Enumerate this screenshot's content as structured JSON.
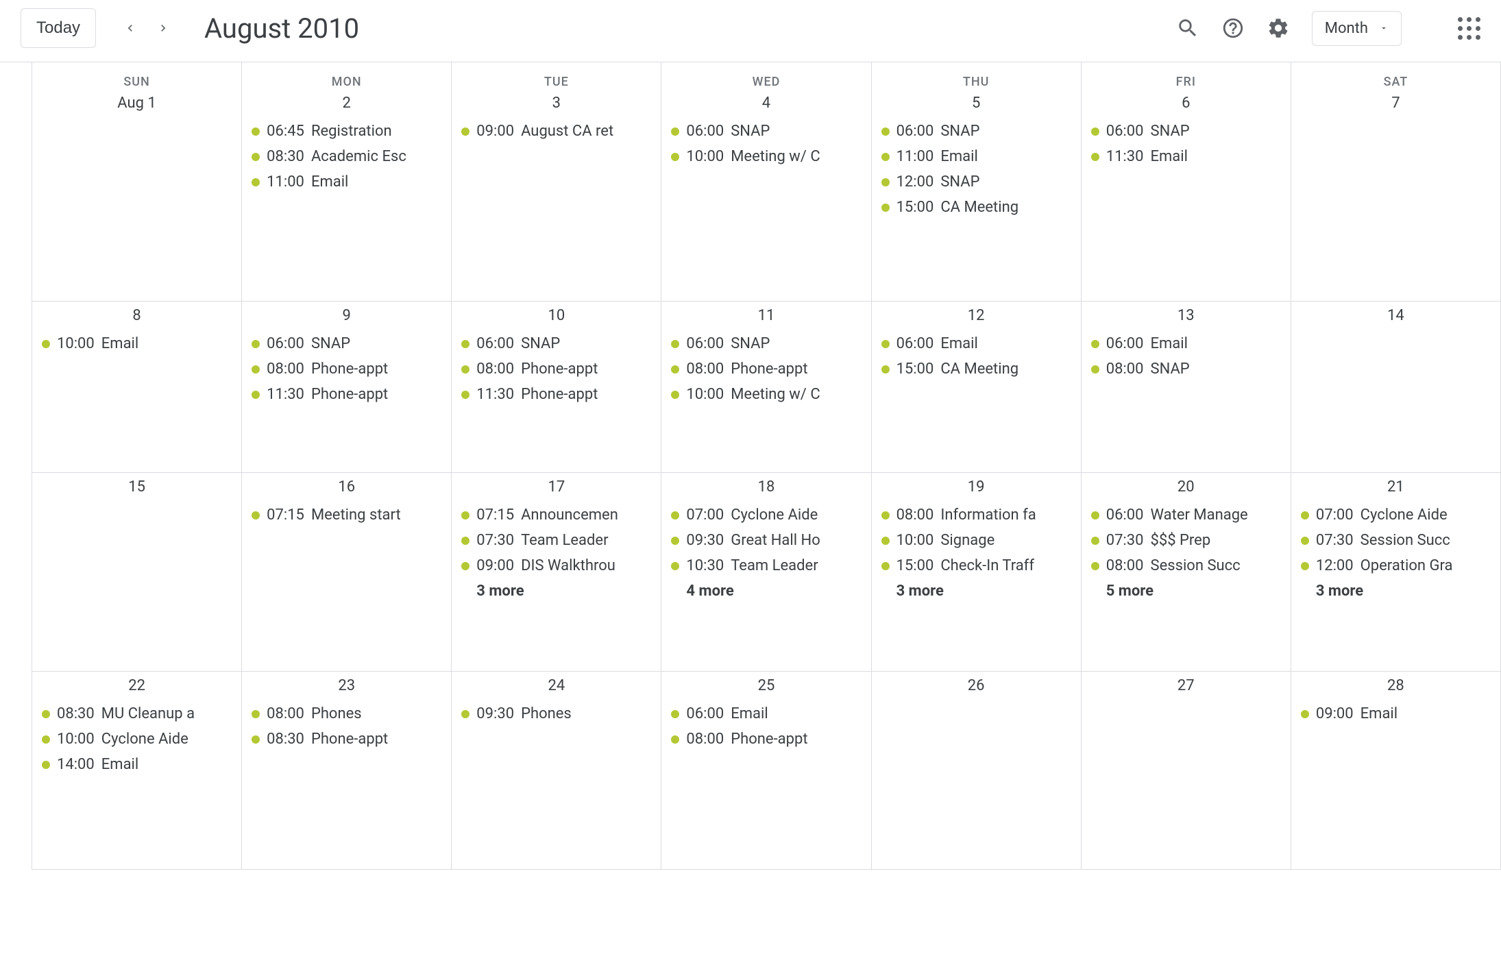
{
  "header": {
    "today_label": "Today",
    "month_title": "August 2010",
    "view_label": "Month"
  },
  "weekdays": [
    "SUN",
    "MON",
    "TUE",
    "WED",
    "THU",
    "FRI",
    "SAT"
  ],
  "event_dot_color": "#b3c833",
  "weeks": [
    [
      {
        "num": "Aug 1",
        "events": [],
        "more": ""
      },
      {
        "num": "2",
        "events": [
          {
            "time": "06:45",
            "title": "Registration"
          },
          {
            "time": "08:30",
            "title": "Academic Esc"
          },
          {
            "time": "11:00",
            "title": "Email"
          }
        ],
        "more": ""
      },
      {
        "num": "3",
        "events": [
          {
            "time": "09:00",
            "title": "August CA ret"
          }
        ],
        "more": ""
      },
      {
        "num": "4",
        "events": [
          {
            "time": "06:00",
            "title": "SNAP"
          },
          {
            "time": "10:00",
            "title": "Meeting w/ C"
          }
        ],
        "more": ""
      },
      {
        "num": "5",
        "events": [
          {
            "time": "06:00",
            "title": "SNAP"
          },
          {
            "time": "11:00",
            "title": "Email"
          },
          {
            "time": "12:00",
            "title": "SNAP"
          },
          {
            "time": "15:00",
            "title": "CA Meeting"
          }
        ],
        "more": ""
      },
      {
        "num": "6",
        "events": [
          {
            "time": "06:00",
            "title": "SNAP"
          },
          {
            "time": "11:30",
            "title": "Email"
          }
        ],
        "more": ""
      },
      {
        "num": "7",
        "events": [],
        "more": ""
      }
    ],
    [
      {
        "num": "8",
        "events": [
          {
            "time": "10:00",
            "title": "Email"
          }
        ],
        "more": ""
      },
      {
        "num": "9",
        "events": [
          {
            "time": "06:00",
            "title": "SNAP"
          },
          {
            "time": "08:00",
            "title": "Phone-appt"
          },
          {
            "time": "11:30",
            "title": "Phone-appt"
          }
        ],
        "more": ""
      },
      {
        "num": "10",
        "events": [
          {
            "time": "06:00",
            "title": "SNAP"
          },
          {
            "time": "08:00",
            "title": "Phone-appt"
          },
          {
            "time": "11:30",
            "title": "Phone-appt"
          }
        ],
        "more": ""
      },
      {
        "num": "11",
        "events": [
          {
            "time": "06:00",
            "title": "SNAP"
          },
          {
            "time": "08:00",
            "title": "Phone-appt"
          },
          {
            "time": "10:00",
            "title": "Meeting w/ C"
          }
        ],
        "more": ""
      },
      {
        "num": "12",
        "events": [
          {
            "time": "06:00",
            "title": "Email"
          },
          {
            "time": "15:00",
            "title": "CA Meeting"
          }
        ],
        "more": ""
      },
      {
        "num": "13",
        "events": [
          {
            "time": "06:00",
            "title": "Email"
          },
          {
            "time": "08:00",
            "title": "SNAP"
          }
        ],
        "more": ""
      },
      {
        "num": "14",
        "events": [],
        "more": ""
      }
    ],
    [
      {
        "num": "15",
        "events": [],
        "more": ""
      },
      {
        "num": "16",
        "events": [
          {
            "time": "07:15",
            "title": "Meeting start"
          }
        ],
        "more": ""
      },
      {
        "num": "17",
        "events": [
          {
            "time": "07:15",
            "title": "Announcemen"
          },
          {
            "time": "07:30",
            "title": "Team Leader"
          },
          {
            "time": "09:00",
            "title": "DIS Walkthrou"
          }
        ],
        "more": "3 more"
      },
      {
        "num": "18",
        "events": [
          {
            "time": "07:00",
            "title": "Cyclone Aide"
          },
          {
            "time": "09:30",
            "title": "Great Hall Ho"
          },
          {
            "time": "10:30",
            "title": "Team Leader"
          }
        ],
        "more": "4 more"
      },
      {
        "num": "19",
        "events": [
          {
            "time": "08:00",
            "title": "Information fa"
          },
          {
            "time": "10:00",
            "title": "Signage"
          },
          {
            "time": "15:00",
            "title": "Check-In Traff"
          }
        ],
        "more": "3 more"
      },
      {
        "num": "20",
        "events": [
          {
            "time": "06:00",
            "title": "Water Manage"
          },
          {
            "time": "07:30",
            "title": "$$$ Prep"
          },
          {
            "time": "08:00",
            "title": "Session Succ"
          }
        ],
        "more": "5 more"
      },
      {
        "num": "21",
        "events": [
          {
            "time": "07:00",
            "title": "Cyclone Aide"
          },
          {
            "time": "07:30",
            "title": "Session Succ"
          },
          {
            "time": "12:00",
            "title": "Operation Gra"
          }
        ],
        "more": "3 more"
      }
    ],
    [
      {
        "num": "22",
        "events": [
          {
            "time": "08:30",
            "title": "MU Cleanup a"
          },
          {
            "time": "10:00",
            "title": "Cyclone Aide"
          },
          {
            "time": "14:00",
            "title": "Email"
          }
        ],
        "more": ""
      },
      {
        "num": "23",
        "events": [
          {
            "time": "08:00",
            "title": "Phones"
          },
          {
            "time": "08:30",
            "title": "Phone-appt"
          }
        ],
        "more": ""
      },
      {
        "num": "24",
        "events": [
          {
            "time": "09:30",
            "title": "Phones"
          }
        ],
        "more": ""
      },
      {
        "num": "25",
        "events": [
          {
            "time": "06:00",
            "title": "Email"
          },
          {
            "time": "08:00",
            "title": "Phone-appt"
          }
        ],
        "more": ""
      },
      {
        "num": "26",
        "events": [],
        "more": ""
      },
      {
        "num": "27",
        "events": [],
        "more": ""
      },
      {
        "num": "28",
        "events": [
          {
            "time": "09:00",
            "title": "Email"
          }
        ],
        "more": ""
      }
    ]
  ]
}
